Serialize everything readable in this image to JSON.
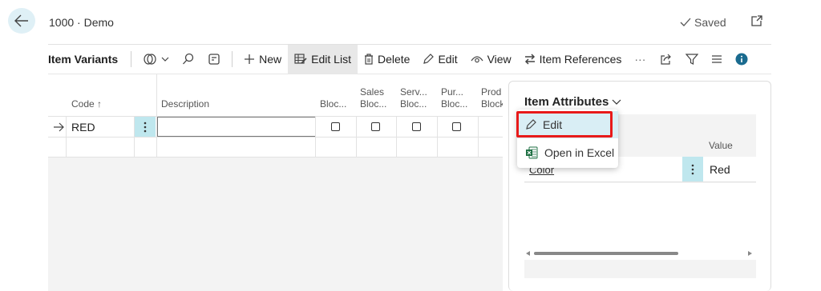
{
  "header": {
    "title": "1000 · Demo",
    "saved": "Saved"
  },
  "actionbar": {
    "page_name": "Item Variants",
    "new": "New",
    "edit_list": "Edit List",
    "delete": "Delete",
    "edit": "Edit",
    "view": "View",
    "item_references": "Item References",
    "more": "···"
  },
  "grid": {
    "columns": {
      "code": "Code ↑",
      "description": "Description",
      "blocked": "Bloc...",
      "sales_blocked_1": "Sales",
      "sales_blocked_2": "Bloc...",
      "service_blocked_1": "Serv...",
      "service_blocked_2": "Bloc...",
      "purchase_blocked_1": "Pur...",
      "purchase_blocked_2": "Bloc...",
      "production_blocked_1": "Prod",
      "production_blocked_2": "Block"
    },
    "rows": [
      {
        "code": "RED",
        "description": ""
      }
    ]
  },
  "factbox": {
    "title": "Item Attributes",
    "value_header": "Value",
    "rows": [
      {
        "attribute": "Color",
        "value": "Red"
      }
    ]
  },
  "menu": {
    "edit": "Edit",
    "open_in_excel": "Open in Excel"
  },
  "colors": {
    "accent": "#0078a8",
    "highlight": "#e81a1a",
    "row_select": "#bfe7ee"
  }
}
